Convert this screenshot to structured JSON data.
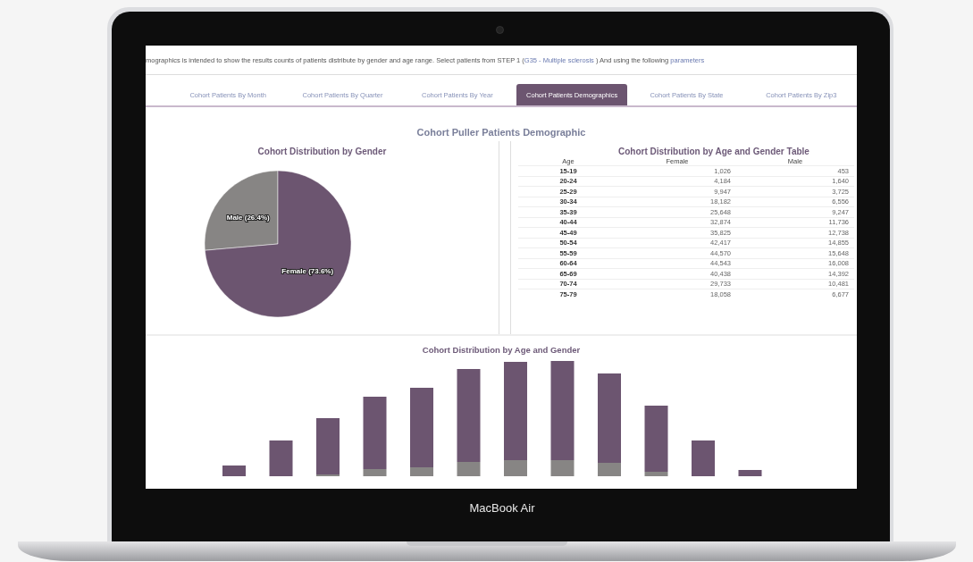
{
  "device": {
    "label": "MacBook Air"
  },
  "intro": {
    "text": "mographics is intended to show the results counts of patients distribute by gender and age range. Select patients from STEP 1 (",
    "link": "G35 - Multiple sclerosis",
    "middle": ") And using the following",
    "link2": "parameters"
  },
  "tabs": [
    {
      "label": "Cohort Patients By Month",
      "selected": false
    },
    {
      "label": "Cohort Patients By Quarter",
      "selected": false
    },
    {
      "label": "Cohort Patients By Year",
      "selected": false
    },
    {
      "label": "Cohort Patients Demographics",
      "selected": true
    },
    {
      "label": "Cohort Patients By State",
      "selected": false
    },
    {
      "label": "Cohort Patients By Zip3",
      "selected": false
    }
  ],
  "page_title": "Cohort Puller Patients Demographic",
  "gender_chart": {
    "title": "Cohort Distribution by Gender",
    "chart_data": {
      "type": "pie",
      "values": [
        26.4,
        73.6
      ],
      "value_labels": [
        "Male (26.4%)",
        "Female (73.6%)"
      ]
    }
  },
  "age_table": {
    "title": "Cohort Distribution by Age and Gender Table",
    "columns": [
      "Age",
      "Female",
      "Male"
    ],
    "rows": [
      [
        "15-19",
        "1,026",
        "453"
      ],
      [
        "20-24",
        "4,184",
        "1,640"
      ],
      [
        "25-29",
        "9,947",
        "3,725"
      ],
      [
        "30-34",
        "18,182",
        "6,556"
      ],
      [
        "35-39",
        "25,648",
        "9,247"
      ],
      [
        "40-44",
        "32,874",
        "11,736"
      ],
      [
        "45-49",
        "35,825",
        "12,738"
      ],
      [
        "50-54",
        "42,417",
        "14,855"
      ],
      [
        "55-59",
        "44,570",
        "15,648"
      ],
      [
        "60-64",
        "44,543",
        "16,008"
      ],
      [
        "65-69",
        "40,438",
        "14,392"
      ],
      [
        "70-74",
        "29,733",
        "10,481"
      ],
      [
        "75-79",
        "18,058",
        "6,677"
      ]
    ]
  },
  "age_chart": {
    "title": "Cohort Distribution by Age and Gender"
  }
}
